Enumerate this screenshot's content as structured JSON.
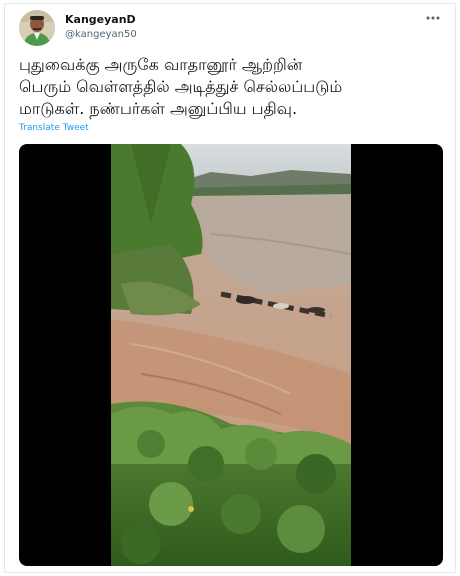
{
  "tweet": {
    "author_name": "KangeyanD",
    "author_handle": "@kangeyan50",
    "more_icon": "more-horizontal-icon",
    "text_lines": [
      "புதுவைக்கு அருகே வாதானூர் ஆற்றின்",
      "பெரும் வெள்ளத்தில் அடித்துச் செல்லப்படும்",
      "மாடுகள். நண்பர்கள் அனுப்பிய பதிவு."
    ],
    "translate_label": "Translate Tweet"
  },
  "colors": {
    "link": "#1d9bf0",
    "muted": "#536471",
    "text": "#0f1419",
    "border": "#e1e8ed",
    "video_background": "#000000"
  },
  "media": {
    "type": "video"
  }
}
